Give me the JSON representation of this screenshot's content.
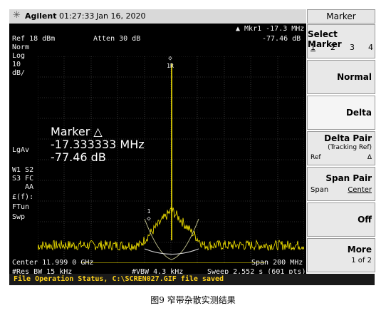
{
  "topbar": {
    "brand": "Agilent",
    "time": "01:27:33",
    "date": "Jan 16, 2020",
    "logo_icon": "asterisk-icon"
  },
  "readout": {
    "mkr": "▲ Mkr1  -17.3 MHz",
    "ref": "Ref 18 dBm",
    "atten": "Atten 30 dB",
    "mkr_val": "-77.46 dB",
    "norm": "Norm",
    "log": "Log",
    "scale": "10",
    "unit": "dB/",
    "lgav": "LgAv",
    "w1": "W1  S2",
    "s3": "S3  FC",
    "aa": "AA",
    "ef": "£(f):",
    "ftun": "FTun",
    "swp": "Swp",
    "marker_1r": "1R",
    "marker_1": "1"
  },
  "marker_box": {
    "title": "Marker △",
    "freq": "-17.333333 MHz",
    "amp": "-77.46 dB"
  },
  "footer": {
    "center": "Center 11.999 0 GHz",
    "span": "Span 200 MHz",
    "res_bw": "#Res BW 15 kHz",
    "vbw": "#VBW 4.3 kHz",
    "sweep": "Sweep 2.552 s (601 pts)"
  },
  "status_bar": "File Operation Status, C:\\SCREN027.GIF file saved",
  "softkeys": {
    "title": "Marker",
    "select": {
      "label": "Select Marker",
      "options": [
        "1",
        "2",
        "3",
        "4"
      ]
    },
    "normal": "Normal",
    "delta": "Delta",
    "delta_pair": {
      "label": "Delta Pair",
      "sub": "(Tracking Ref)",
      "left": "Ref",
      "right": "Δ"
    },
    "span_pair": {
      "label": "Span Pair",
      "left": "Span",
      "right": "Center"
    },
    "off": "Off",
    "more": {
      "label": "More",
      "sub": "1 of 2"
    }
  },
  "caption": "图9   窄带杂散实测结果",
  "colors": {
    "trace": "#ffee00",
    "screen": "#000000",
    "status_text": "#ffd21a"
  }
}
